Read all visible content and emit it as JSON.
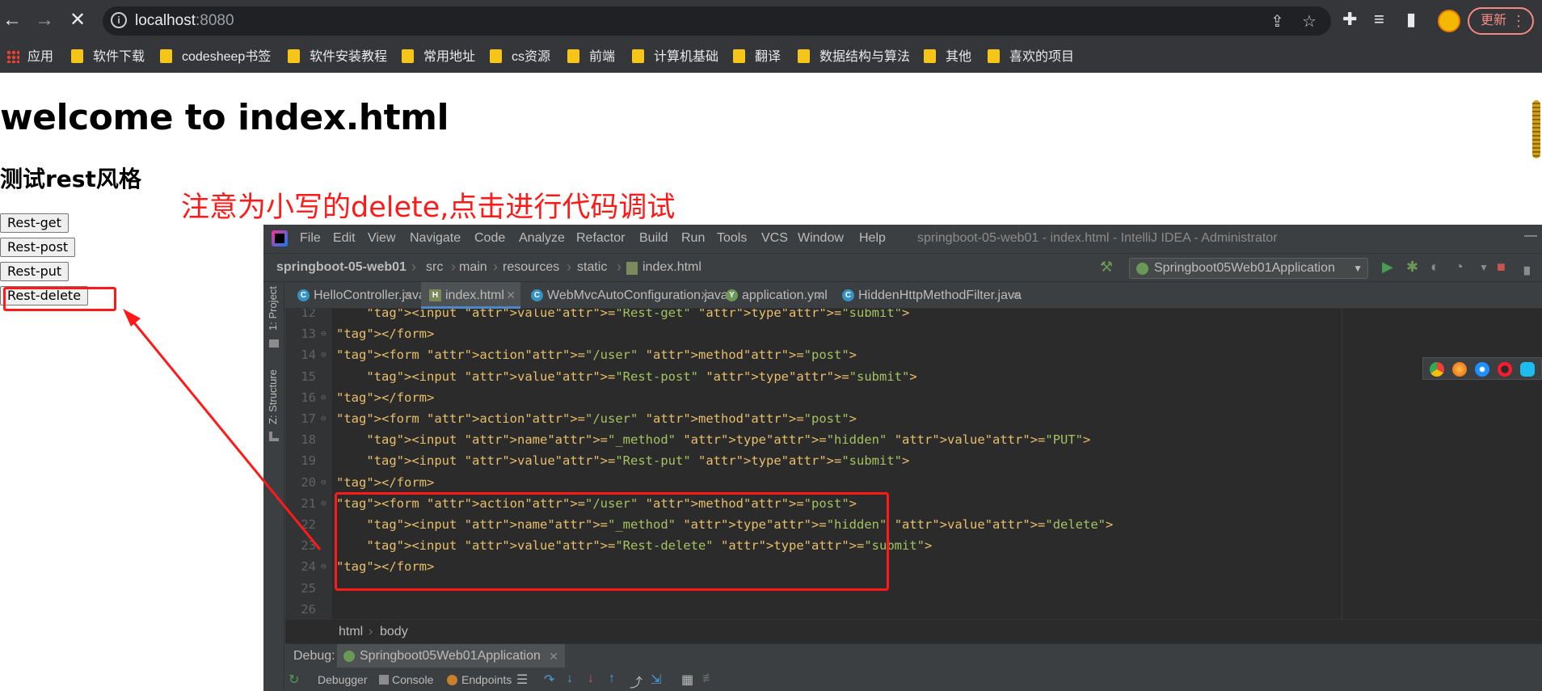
{
  "browser": {
    "url_host": "localhost",
    "url_port": ":8080",
    "update_label": "更新"
  },
  "bookmarks": [
    {
      "label": "应用"
    },
    {
      "label": "软件下载"
    },
    {
      "label": "codesheep书签"
    },
    {
      "label": "软件安装教程"
    },
    {
      "label": "常用地址"
    },
    {
      "label": "cs资源"
    },
    {
      "label": "前端"
    },
    {
      "label": "计算机基础"
    },
    {
      "label": "翻译"
    },
    {
      "label": "数据结构与算法"
    },
    {
      "label": "其他"
    },
    {
      "label": "喜欢的项目"
    }
  ],
  "page": {
    "title": "welcome to index.html",
    "subtitle": "测试rest风格",
    "buttons": [
      "Rest-get",
      "Rest-post",
      "Rest-put",
      "Rest-delete"
    ],
    "annotation": "注意为小写的delete,点击进行代码调试"
  },
  "ide": {
    "menu": [
      "File",
      "Edit",
      "View",
      "Navigate",
      "Code",
      "Analyze",
      "Refactor",
      "Build",
      "Run",
      "Tools",
      "VCS",
      "Window",
      "Help"
    ],
    "window_title": "springboot-05-web01 - index.html - IntelliJ IDEA - Administrator",
    "breadcrumb": [
      "springboot-05-web01",
      "src",
      "main",
      "resources",
      "static",
      "index.html"
    ],
    "run_config": "Springboot05Web01Application",
    "side_panels": [
      "1: Project",
      "Z: Structure"
    ],
    "tabs": [
      {
        "label": "HelloController.java",
        "icon": "C"
      },
      {
        "label": "index.html",
        "icon": "H"
      },
      {
        "label": "WebMvcAutoConfiguration.java",
        "icon": "C"
      },
      {
        "label": "application.yml",
        "icon": "Y"
      },
      {
        "label": "HiddenHttpMethodFilter.java",
        "icon": "C"
      }
    ],
    "code_lines": [
      {
        "n": "12",
        "html": "    &lt;input value=\"Rest-get\" type=\"submit\"&gt;"
      },
      {
        "n": "13",
        "html": "&lt;/form&gt;"
      },
      {
        "n": "14",
        "html": "&lt;form action=\"/user\" method=\"post\"&gt;"
      },
      {
        "n": "15",
        "html": "    &lt;input value=\"Rest-post\" type=\"submit\"&gt;"
      },
      {
        "n": "16",
        "html": "&lt;/form&gt;"
      },
      {
        "n": "17",
        "html": "&lt;form action=\"/user\" method=\"post\"&gt;"
      },
      {
        "n": "18",
        "html": "    &lt;input name=\"_method\" type=\"hidden\" value=\"PUT\"&gt;"
      },
      {
        "n": "19",
        "html": "    &lt;input value=\"Rest-put\" type=\"submit\"&gt;"
      },
      {
        "n": "20",
        "html": "&lt;/form&gt;"
      },
      {
        "n": "21",
        "html": "&lt;form action=\"/user\" method=\"post\"&gt;"
      },
      {
        "n": "22",
        "html": "    &lt;input name=\"_method\" type=\"hidden\" value=\"delete\"&gt;"
      },
      {
        "n": "23",
        "html": "    &lt;input value=\"Rest-delete\" type=\"submit\"&gt;"
      },
      {
        "n": "24",
        "html": "&lt;/form&gt;"
      },
      {
        "n": "25",
        "html": ""
      },
      {
        "n": "26",
        "html": ""
      }
    ],
    "editor_breadcrumb": [
      "html",
      "body"
    ],
    "debug_label": "Debug:",
    "debug_tab": "Springboot05Web01Application",
    "debug_tools": [
      "Debugger",
      "Console",
      "Endpoints"
    ]
  }
}
